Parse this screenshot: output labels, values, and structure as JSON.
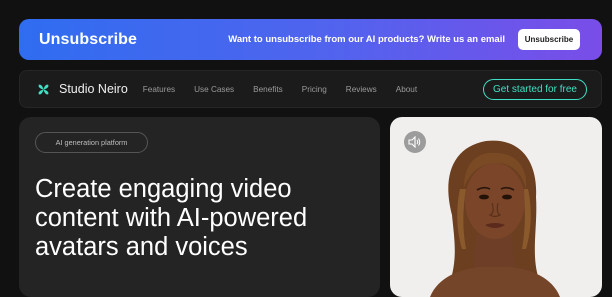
{
  "banner": {
    "title": "Unsubscribe",
    "message": "Want to unsubscribe from our AI products? Write us an email",
    "button_label": "Unsubscribe",
    "gradient": [
      "#2f6df0",
      "#7a4de8"
    ]
  },
  "nav": {
    "brand": "Studio Neiro",
    "logo_icon": "four-petal-logo-icon",
    "links": [
      "Features",
      "Use Cases",
      "Benefits",
      "Pricing",
      "Reviews",
      "About"
    ],
    "cta_label": "Get started for free",
    "accent": "#3fe0c5"
  },
  "hero": {
    "chip_label": "AI generation platform",
    "headline_lines": [
      "Create engaging video",
      "content with AI-powered",
      "avatars and voices"
    ]
  },
  "media": {
    "sound_icon": "speaker-icon"
  }
}
